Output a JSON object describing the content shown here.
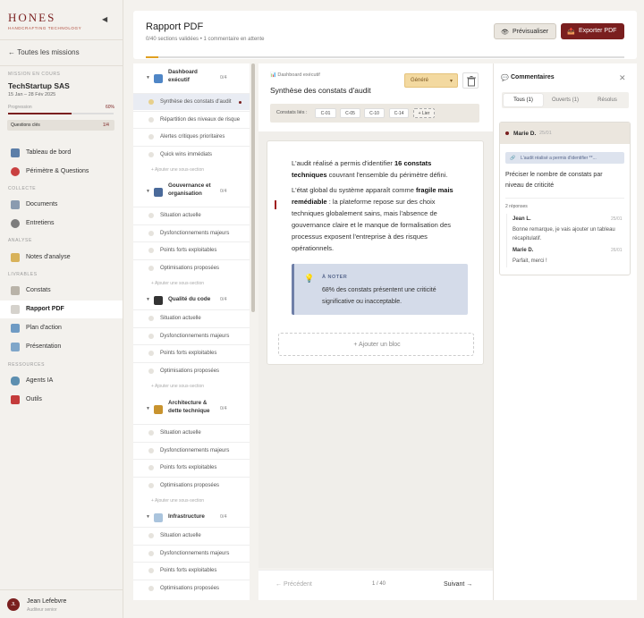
{
  "brand": {
    "name": "HONES",
    "tagline": "HANDCRAFTING TECHNOLOGY"
  },
  "sidebar": {
    "back_label": "Toutes les missions",
    "mission_section": "MISSION EN COURS",
    "mission_name": "TechStartup SAS",
    "mission_dates": "15 Jan – 28 Fév 2025",
    "progress_label": "Progression",
    "progress_value": "60%",
    "progress_fraction": 0.6,
    "key_questions_label": "Questions clés",
    "key_questions_value": "1/4",
    "nav_main": [
      {
        "label": "Tableau de bord",
        "icon": "dashboard-icon"
      },
      {
        "label": "Périmètre & Questions",
        "icon": "target-icon"
      }
    ],
    "section_collecte": "COLLECTE",
    "nav_collecte": [
      {
        "label": "Documents",
        "icon": "document-icon"
      },
      {
        "label": "Entretiens",
        "icon": "microphone-icon"
      }
    ],
    "section_analyse": "ANALYSE",
    "nav_analyse": [
      {
        "label": "Notes d'analyse",
        "icon": "notes-icon"
      }
    ],
    "section_livrables": "LIVRABLES",
    "nav_livrables": [
      {
        "label": "Constats",
        "icon": "constats-icon"
      },
      {
        "label": "Rapport PDF",
        "icon": "pdf-icon",
        "active": true
      },
      {
        "label": "Plan d'action",
        "icon": "map-icon"
      },
      {
        "label": "Présentation",
        "icon": "presentation-icon"
      }
    ],
    "section_ressources": "RESSOURCES",
    "nav_ressources": [
      {
        "label": "Agents IA",
        "icon": "robot-icon"
      },
      {
        "label": "Outils",
        "icon": "toolbox-icon"
      }
    ],
    "user": {
      "initials": "JL",
      "name": "Jean Lefebvre",
      "role": "Auditeur senior"
    }
  },
  "header": {
    "title": "Rapport PDF",
    "subtitle": "0/40 sections validées • 1 commentaire en attente",
    "preview_label": "Prévisualiser",
    "export_label": "Exporter PDF",
    "progress_fraction": 0.025
  },
  "outline": {
    "sections": [
      {
        "title_line1": "Dashboard",
        "title_line2": "exécutif",
        "count": "0/4",
        "icon": "chart-icon",
        "items": [
          "Synthèse des constats d'audit",
          "Répartition des niveaux de risque",
          "Alertes critiques prioritaires",
          "Quick wins immédiats"
        ]
      },
      {
        "title_line1": "Gouvernance et",
        "title_line2": "organisation",
        "count": "0/4",
        "icon": "people-icon",
        "items": [
          "Situation actuelle",
          "Dysfonctionnements majeurs",
          "Points forts exploitables",
          "Optimisations proposées"
        ]
      },
      {
        "title_line1": "Qualité du code",
        "title_line2": "",
        "count": "0/4",
        "icon": "laptop-icon",
        "items": [
          "Situation actuelle",
          "Dysfonctionnements majeurs",
          "Points forts exploitables",
          "Optimisations proposées"
        ]
      },
      {
        "title_line1": "Architecture &",
        "title_line2": "dette technique",
        "count": "0/4",
        "icon": "crane-icon",
        "items": [
          "Situation actuelle",
          "Dysfonctionnements majeurs",
          "Points forts exploitables",
          "Optimisations proposées"
        ]
      },
      {
        "title_line1": "Infrastructure",
        "title_line2": "",
        "count": "0/4",
        "icon": "cloud-icon",
        "items": [
          "Situation actuelle",
          "Dysfonctionnements majeurs",
          "Points forts exploitables",
          "Optimisations proposées"
        ]
      }
    ],
    "add_sub_label": "+ Ajouter une sous-section"
  },
  "editor": {
    "crumb": "Dashboard exécutif",
    "title": "Synthèse des constats d'audit",
    "status": "Généré",
    "linked_label": "Constats liés :",
    "linked": [
      "C-01",
      "C-05",
      "C-10",
      "C-14"
    ],
    "link_button": "+ Lier",
    "p1_a": "L'audit réalisé a permis d'identifier ",
    "p1_b": "16 constats techniques",
    "p1_c": " couvrant l'ensemble du périmètre défini.",
    "p2_a": "L'état global du système apparaît comme ",
    "p2_b": "fragile mais remédiable",
    "p2_c": " : la plateforme repose sur des choix techniques globalement sains, mais l'absence de gouvernance claire et le manque de formalisation des processus exposent l'entreprise à des risques opérationnels.",
    "note_title": "À NOTER",
    "note_text": "68% des constats présentent une criticité significative ou inacceptable.",
    "add_block": "+ Ajouter un bloc"
  },
  "pager": {
    "prev": "← Précédent",
    "page": "1 / 40",
    "next": "Suivant →"
  },
  "comments": {
    "title": "Commentaires",
    "tabs": [
      "Tous (1)",
      "Ouverts (1)",
      "Résolus"
    ],
    "author": "Marie D.",
    "date": "25/01",
    "quote": "L'audit réalisé a permis d'identifier **...",
    "body": "Préciser le nombre de constats par niveau de criticité",
    "replies_count": "2 réponses",
    "replies": [
      {
        "author": "Jean L.",
        "date": "25/01",
        "text": "Bonne remarque, je vais ajouter un tableau récapitulatif."
      },
      {
        "author": "Marie D.",
        "date": "26/01",
        "text": "Parfait, merci !"
      }
    ]
  },
  "colors": {
    "brand": "#7a1f1f",
    "accent": "#e0a020",
    "note_bg": "#d4dbe9"
  }
}
